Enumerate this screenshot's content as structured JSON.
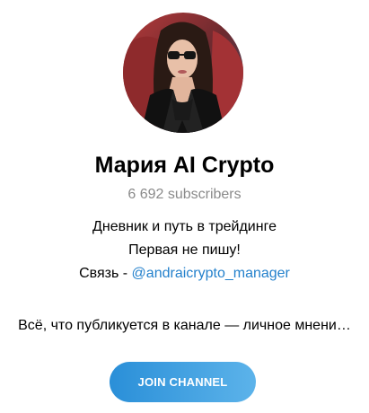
{
  "channel": {
    "name": "Мария AI Crypto",
    "subscribers": "6 692 subscribers",
    "description": {
      "line1": "Дневник и путь в трейдинге",
      "line2": "Первая не пишу!",
      "contact_prefix": "Связь - ",
      "contact_handle": "@andraicrypto_manager"
    },
    "note": "Всё, что публикуется в канале — личное мнени…"
  },
  "actions": {
    "join_label": "JOIN CHANNEL"
  },
  "colors": {
    "link": "#2481cc",
    "button_start": "#2a8fd8",
    "button_end": "#5cb3ea",
    "muted_text": "#8a8a8a"
  }
}
